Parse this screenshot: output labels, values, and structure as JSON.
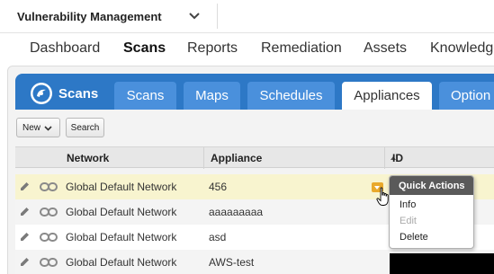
{
  "module_selector": {
    "label": "Vulnerability Management"
  },
  "main_nav": {
    "items": [
      {
        "label": "Dashboard"
      },
      {
        "label": "Scans",
        "active": true
      },
      {
        "label": "Reports"
      },
      {
        "label": "Remediation"
      },
      {
        "label": "Assets"
      },
      {
        "label": "Knowledge"
      }
    ]
  },
  "scans_panel": {
    "brand_label": "Scans",
    "tabs": [
      {
        "label": "Scans"
      },
      {
        "label": "Maps"
      },
      {
        "label": "Schedules"
      },
      {
        "label": "Appliances",
        "active": true
      },
      {
        "label": "Option"
      }
    ]
  },
  "toolbar": {
    "new_label": "New",
    "search_label": "Search"
  },
  "table": {
    "columns": {
      "network": "Network",
      "appliance": "Appliance",
      "id": "ID"
    },
    "sort": {
      "column": "appliance",
      "direction": "ascending"
    },
    "rows": [
      {
        "network": "Global Default Network",
        "appliance": "456",
        "selected": true
      },
      {
        "network": "Global Default Network",
        "appliance": "aaaaaaaaa"
      },
      {
        "network": "Global Default Network",
        "appliance": "asd"
      },
      {
        "network": "Global Default Network",
        "appliance": "AWS-test"
      }
    ]
  },
  "quick_actions": {
    "title": "Quick Actions",
    "items": [
      {
        "label": "Info",
        "enabled": true
      },
      {
        "label": "Edit",
        "enabled": false
      },
      {
        "label": "Delete",
        "enabled": true
      }
    ]
  },
  "colors": {
    "tab_bar": "#2d78c6",
    "tab_inactive": "#4a90dc",
    "selected_row": "#f8f4cf",
    "quick_action_trigger": "#e9a92c",
    "menu_header": "#5a5a5a"
  }
}
